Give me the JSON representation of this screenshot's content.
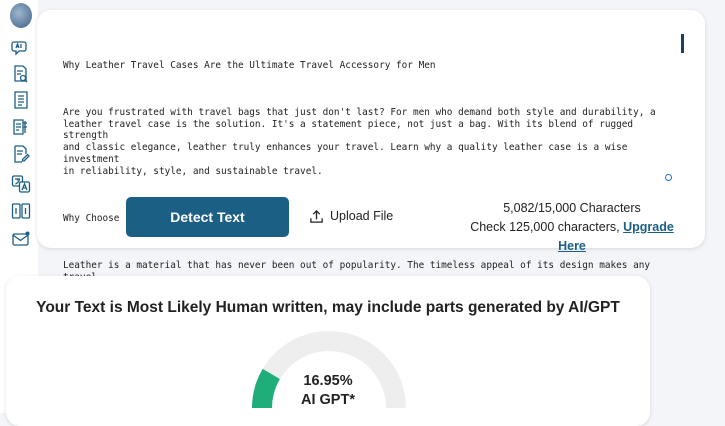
{
  "sidebar": {
    "icons": [
      "ai-chat-icon",
      "document-search-icon",
      "document-list-icon",
      "document-tools-icon",
      "document-edit-icon",
      "translate-icon",
      "compare-icon",
      "email-icon"
    ]
  },
  "editor": {
    "title_line": "Why Leather Travel Cases Are the Ultimate Travel Accessory for Men",
    "paragraph_1": "Are you frustrated with travel bags that just don't last? For men who demand both style and durability, a\nleather travel case is the solution. It's a statement piece, not just a bag. With its blend of rugged strength\nand classic elegance, leather truly enhances your travel. Learn why a quality leather case is a wise investment\nin reliability, style, and sustainable travel.",
    "heading_2": "Why Choose Leather Bags?",
    "paragraph_2": "Leather is a material that has never been out of popularity. The timeless appeal of its design makes any travel\ncase look more sophisticated and modern. Even the aesthetic value of leather extends beyond that and is useful\nfor travelers who are on frequent trips."
  },
  "actions": {
    "detect_label": "Detect Text",
    "upload_label": "Upload File",
    "char_count": "5,082/15,000 Characters",
    "check_prefix": "Check 125,000 characters, ",
    "upgrade_label": "Upgrade Here"
  },
  "result": {
    "title": "Your Text is Most Likely Human written, may include parts generated by AI/GPT",
    "percent_label": "16.95%",
    "ai_label": "AI GPT*",
    "ai_fraction": 0.1695,
    "colors": {
      "ai": "#1fae7a",
      "human": "#eeeeee",
      "accent": "#1c5f85"
    }
  }
}
